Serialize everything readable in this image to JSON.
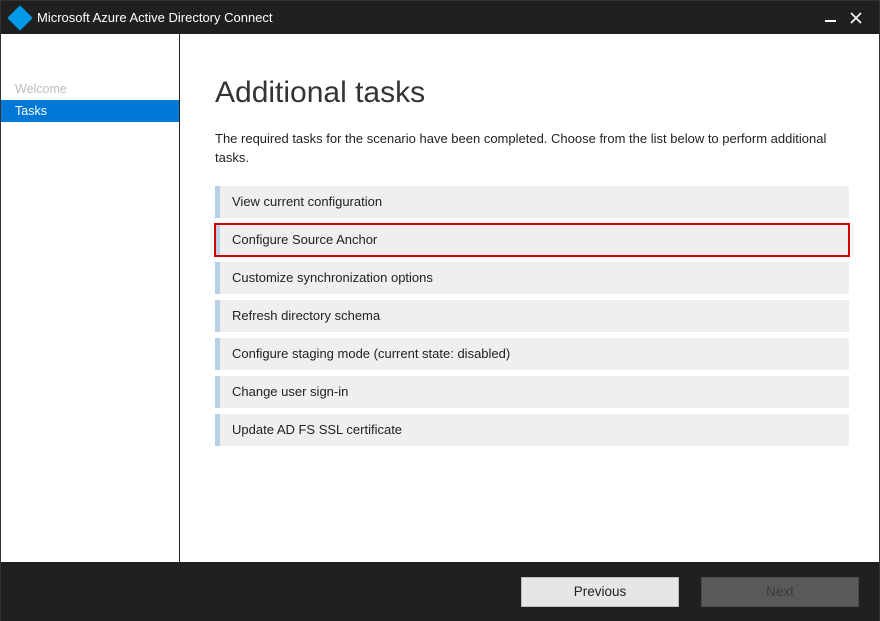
{
  "window": {
    "title": "Microsoft Azure Active Directory Connect"
  },
  "sidebar": {
    "items": [
      {
        "label": "Welcome"
      },
      {
        "label": "Tasks"
      }
    ]
  },
  "main": {
    "heading": "Additional tasks",
    "description": "The required tasks for the scenario have been completed. Choose from the list below to perform additional tasks.",
    "tasks": [
      {
        "label": "View current configuration"
      },
      {
        "label": "Configure Source Anchor"
      },
      {
        "label": "Customize synchronization options"
      },
      {
        "label": "Refresh directory schema"
      },
      {
        "label": "Configure staging mode (current state: disabled)"
      },
      {
        "label": "Change user sign-in"
      },
      {
        "label": "Update AD FS SSL certificate"
      }
    ]
  },
  "footer": {
    "previous_label": "Previous",
    "next_label": "Next"
  }
}
